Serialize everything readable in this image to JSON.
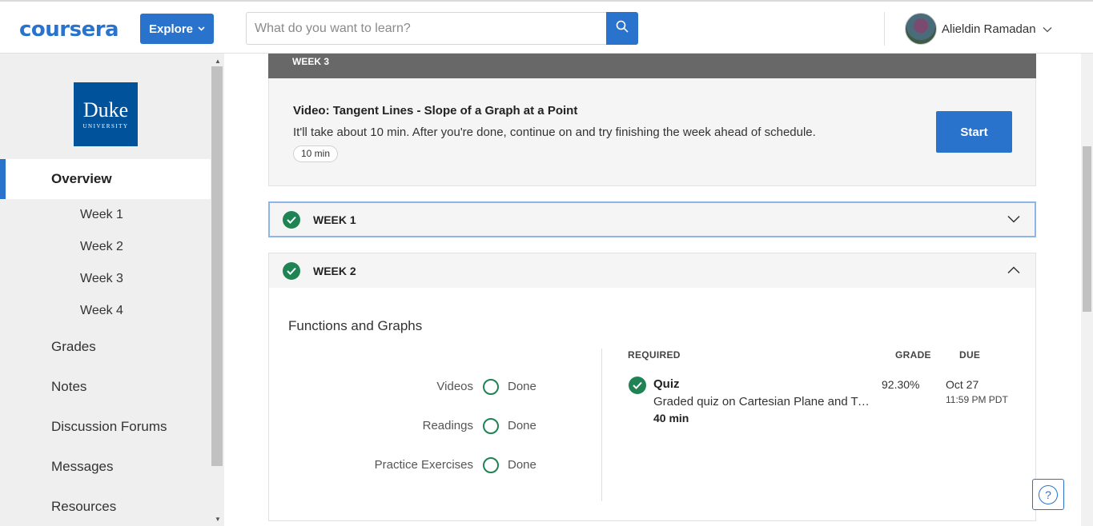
{
  "header": {
    "logo": "coursera",
    "explore_label": "Explore",
    "search_placeholder": "What do you want to learn?",
    "user_name": "Alieldin Ramadan"
  },
  "sidebar": {
    "university_name": "Duke",
    "university_sub": "UNIVERSITY",
    "overview": "Overview",
    "weeks": [
      "Week 1",
      "Week 2",
      "Week 3",
      "Week 4"
    ],
    "items": [
      "Grades",
      "Notes",
      "Discussion Forums",
      "Messages",
      "Resources"
    ]
  },
  "week3": {
    "bar_label": "WEEK 3",
    "title": "Video: Tangent Lines - Slope of a Graph at a Point",
    "subtitle": "It'll take about 10 min. After you're done, continue on and try finishing the week ahead of schedule.",
    "duration": "10 min",
    "start_label": "Start"
  },
  "week1": {
    "label": "WEEK 1"
  },
  "week2": {
    "label": "WEEK 2",
    "heading": "Functions and Graphs",
    "progress": [
      {
        "label": "Videos",
        "status": "Done"
      },
      {
        "label": "Readings",
        "status": "Done"
      },
      {
        "label": "Practice Exercises",
        "status": "Done"
      }
    ],
    "columns": {
      "required": "REQUIRED",
      "grade": "GRADE",
      "due": "DUE"
    },
    "quiz": {
      "title": "Quiz",
      "description": "Graded quiz on Cartesian Plane and Types of Functions",
      "duration": "40 min",
      "grade": "92.30%",
      "due_date": "Oct 27",
      "due_time": "11:59 PM PDT"
    }
  },
  "help_label": "?",
  "colors": {
    "accent": "#2a73cc",
    "success": "#1f8354",
    "week_bar": "#686868"
  },
  "icons": [
    "search-icon",
    "chevron-down-icon",
    "chevron-up-icon",
    "check-icon",
    "help-icon"
  ]
}
